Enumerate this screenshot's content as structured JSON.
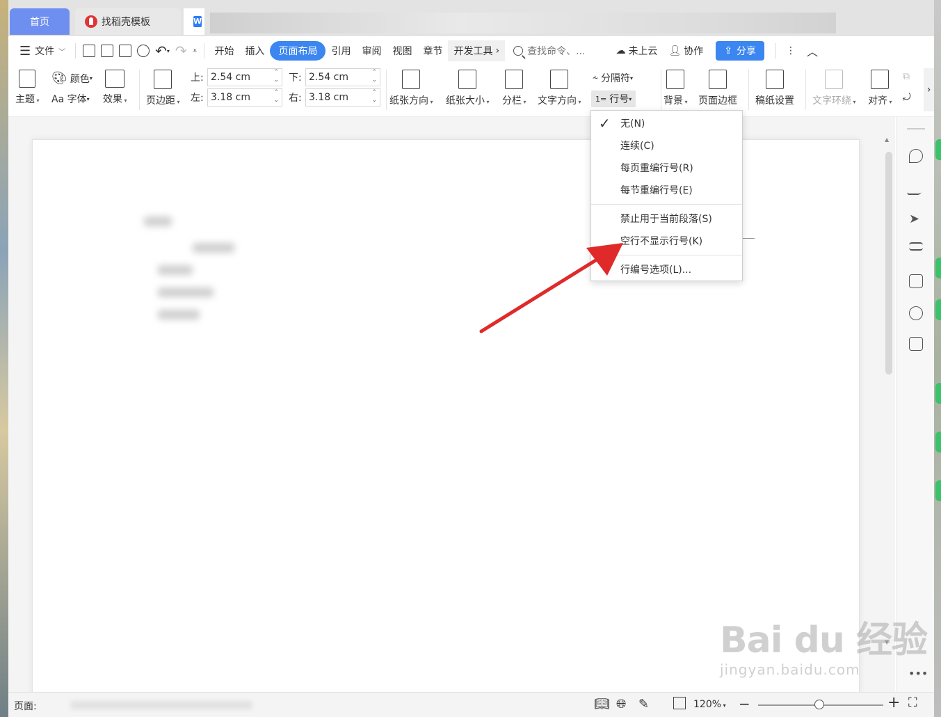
{
  "tabs": {
    "home": "首页",
    "template": "找稻壳模板",
    "doc_icon": "W"
  },
  "menubar": {
    "file": "文件",
    "items": [
      "开始",
      "插入",
      "页面布局",
      "引用",
      "审阅",
      "视图",
      "章节",
      "开发工具"
    ],
    "active": "页面布局",
    "search_placeholder": "查找命令、...",
    "cloud": "未上云",
    "collab": "协作",
    "share": "分享"
  },
  "ribbon": {
    "theme": "主题",
    "color": "颜色",
    "font": "Aa 字体",
    "effect": "效果",
    "margins": "页边距",
    "top_label": "上:",
    "top_value": "2.54 cm",
    "bottom_label": "下:",
    "bottom_value": "2.54 cm",
    "left_label": "左:",
    "left_value": "3.18 cm",
    "right_label": "右:",
    "right_value": "3.18 cm",
    "orientation": "纸张方向",
    "size": "纸张大小",
    "columns": "分栏",
    "text_direction": "文字方向",
    "breaks": "分隔符",
    "line_numbers": "行号",
    "background": "背景",
    "page_border": "页面边框",
    "manuscript": "稿纸设置",
    "wrap": "文字环绕",
    "align": "对齐"
  },
  "dropdown": {
    "items": [
      {
        "label": "无(N)",
        "checked": true
      },
      {
        "label": "连续(C)",
        "checked": false
      },
      {
        "label": "每页重编行号(R)",
        "checked": false
      },
      {
        "label": "每节重编行号(E)",
        "checked": false
      },
      {
        "label": "禁止用于当前段落(S)",
        "checked": false
      },
      {
        "label": "空行不显示行号(K)",
        "checked": false
      },
      {
        "label": "行编号选项(L)...",
        "checked": false
      }
    ]
  },
  "statusbar": {
    "page": "页面:",
    "zoom": "120%"
  },
  "watermark": {
    "brand": "Bai du 经验",
    "url": "jingyan.baidu.com"
  },
  "colors": {
    "accent": "#3b86f0",
    "arrow": "#e02a2a"
  }
}
